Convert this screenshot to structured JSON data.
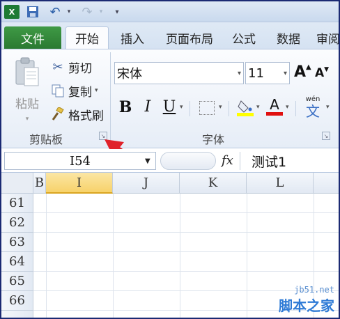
{
  "ribbon": {
    "tabs": [
      "文件",
      "开始",
      "插入",
      "页面布局",
      "公式",
      "数据",
      "审阅"
    ],
    "clipboard": {
      "paste_label": "粘贴",
      "cut_label": "剪切",
      "copy_label": "复制",
      "format_painter_label": "格式刷",
      "group_label": "剪贴板"
    },
    "font": {
      "font_name": "宋体",
      "font_size": "11",
      "group_label": "字体",
      "bold_label": "B",
      "italic_label": "I",
      "underline_label": "U",
      "grow_label": "A",
      "shrink_label": "A",
      "phonetic_label": "wén",
      "phonetic_char": "文",
      "font_color_label": "A"
    }
  },
  "formula_bar": {
    "name_box": "I54",
    "fx_label": "fx",
    "content": "测试1"
  },
  "grid": {
    "columns": [
      "B",
      "I",
      "J",
      "K",
      "L"
    ],
    "rows": [
      "61",
      "62",
      "63",
      "64",
      "65",
      "66"
    ]
  },
  "watermark": {
    "site": "jb51.net",
    "brand": "脚本之家"
  },
  "colors": {
    "file_tab": "#2a7a32",
    "selected_col": "#f7d26a",
    "arrow": "#e0222a"
  }
}
